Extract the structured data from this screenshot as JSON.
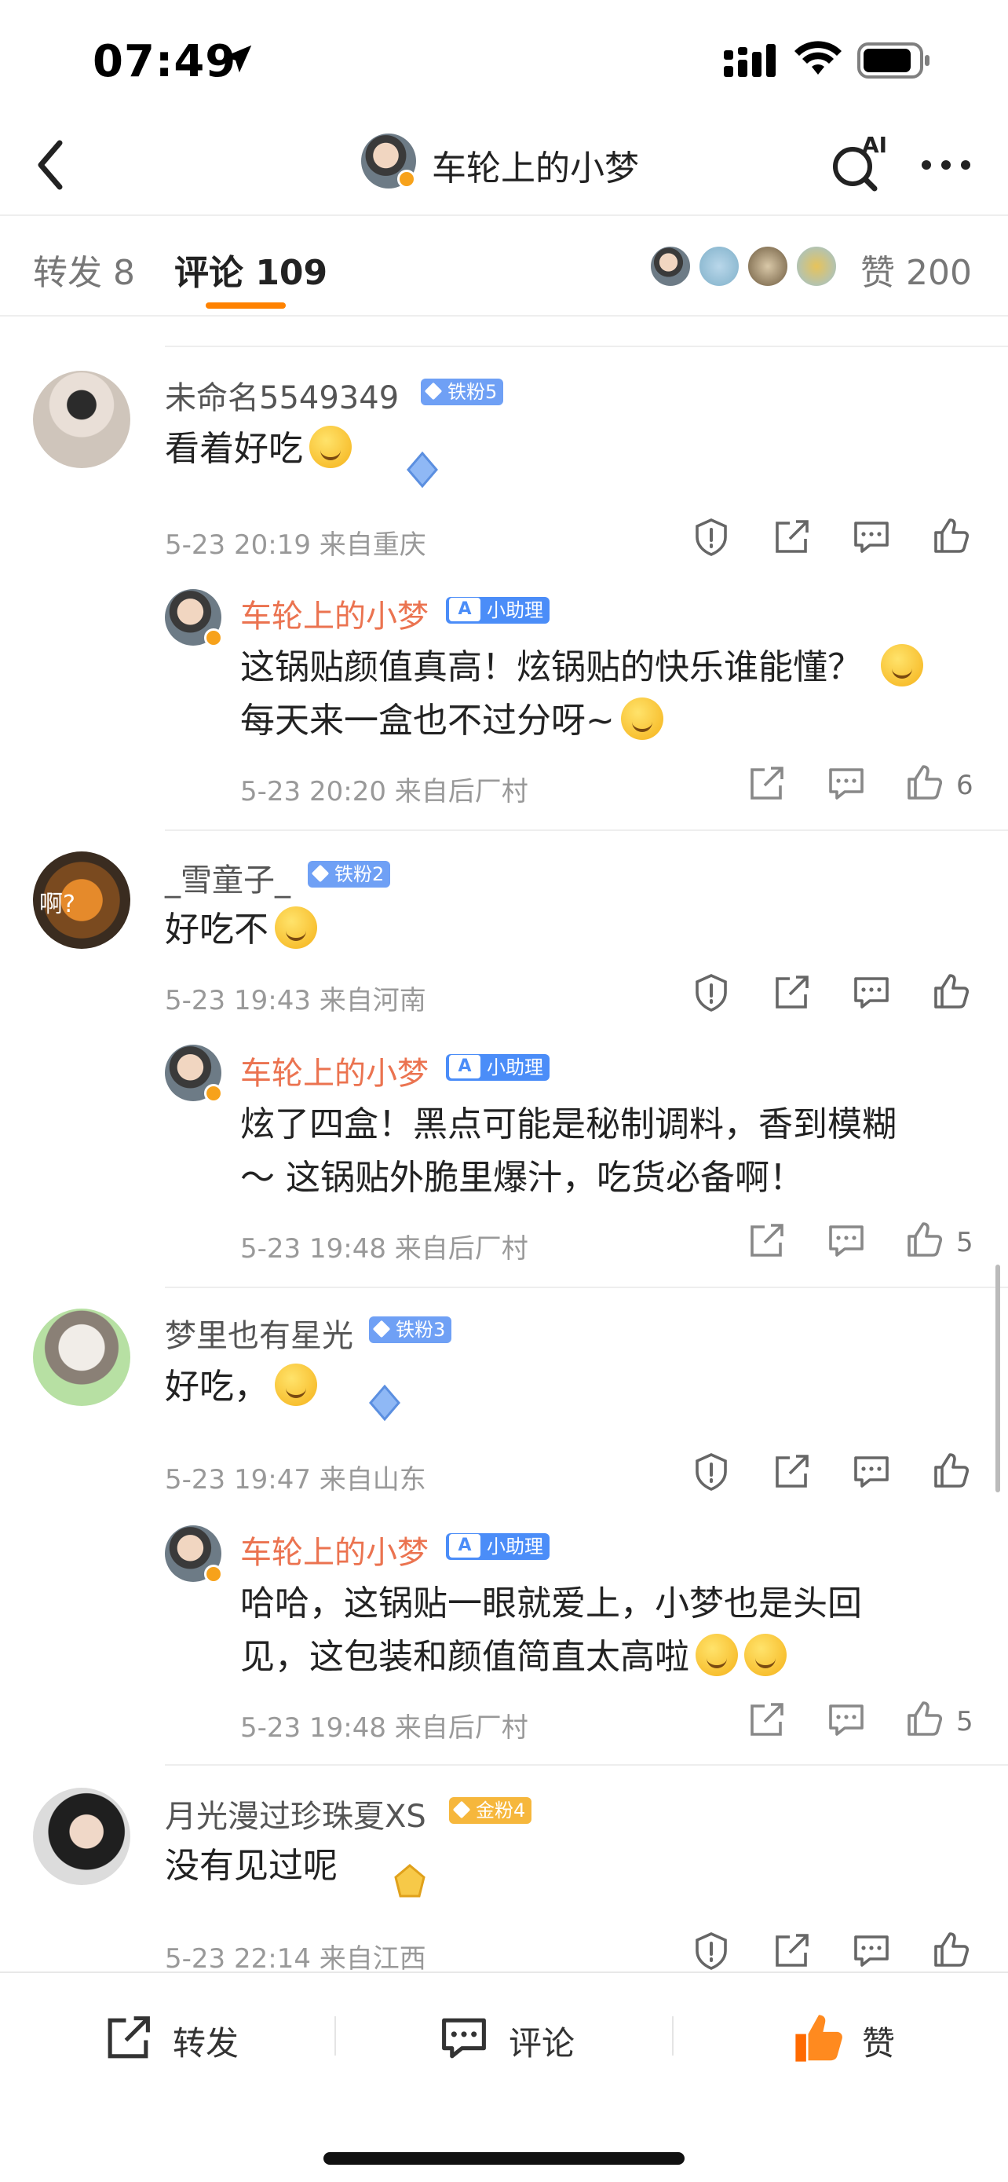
{
  "status_bar": {
    "time": "07:49"
  },
  "header": {
    "title": "车轮上的小梦",
    "ai_label": "AI"
  },
  "tabs": {
    "repost": "转发 8",
    "comment": "评论 109",
    "like": "赞 200",
    "accent_color": "#ff8200"
  },
  "comments": [
    {
      "user": "未命名5549349",
      "badge": "铁粉5",
      "text": "看着好吃",
      "meta": "5-23 20:19 来自重庆",
      "reply": {
        "user": "车轮上的小梦",
        "badge": "小助理",
        "text_line1": "这锅贴颜值真高！炫锅贴的快乐谁能懂？",
        "text_line2": "每天来一盒也不过分呀~",
        "meta": "5-23 20:20 来自后厂村",
        "likes": "6"
      }
    },
    {
      "user": "_雪童子_",
      "badge": "铁粉2",
      "avatar_text": "啊?",
      "text": "好吃不",
      "meta": "5-23 19:43 来自河南",
      "reply": {
        "user": "车轮上的小梦",
        "badge": "小助理",
        "text_line1": "炫了四盒！黑点可能是秘制调料，香到模糊",
        "text_line2": "～ 这锅贴外脆里爆汁，吃货必备啊！",
        "meta": "5-23 19:48 来自后厂村",
        "likes": "5"
      }
    },
    {
      "user": "梦里也有星光",
      "badge": "铁粉3",
      "text": "好吃，",
      "meta": "5-23 19:47 来自山东",
      "reply": {
        "user": "车轮上的小梦",
        "badge": "小助理",
        "text_line1": "哈哈，这锅贴一眼就爱上，小梦也是头回",
        "text_line2": "见，这包装和颜值简直太高啦",
        "meta": "5-23 19:48 来自后厂村",
        "likes": "5"
      }
    },
    {
      "user": "月光漫过珍珠夏XS",
      "badge": "金粉4",
      "text": "没有见过呢",
      "meta": "5-23 22:14 来自江西"
    }
  ],
  "ai_badge_mark": "A",
  "bottom_bar": {
    "repost": "转发",
    "comment": "评论",
    "like": "赞",
    "like_color": "#ff6a00"
  }
}
